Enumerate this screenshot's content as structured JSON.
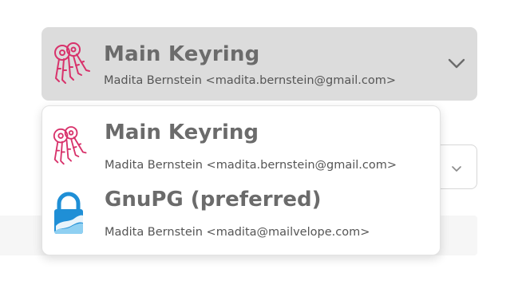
{
  "selected_keyring": {
    "title": "Main Keyring",
    "subtitle": "Madita Bernstein <madita.bernstein@gmail.com>"
  },
  "dropdown": {
    "options": [
      {
        "title": "Main Keyring",
        "subtitle": "Madita Bernstein <madita.bernstein@gmail.com>",
        "icon": "keys-icon"
      },
      {
        "title": "GnuPG (preferred)",
        "subtitle": "Madita Bernstein <madita@mailvelope.com>",
        "icon": "gnupg-lock-icon"
      }
    ]
  },
  "colors": {
    "keys_icon": "#d8326b",
    "gnupg_blue": "#1f8fd6",
    "select_bg": "#dcdcdc",
    "title_text": "#6b6b6b",
    "sub_text": "#555555"
  }
}
